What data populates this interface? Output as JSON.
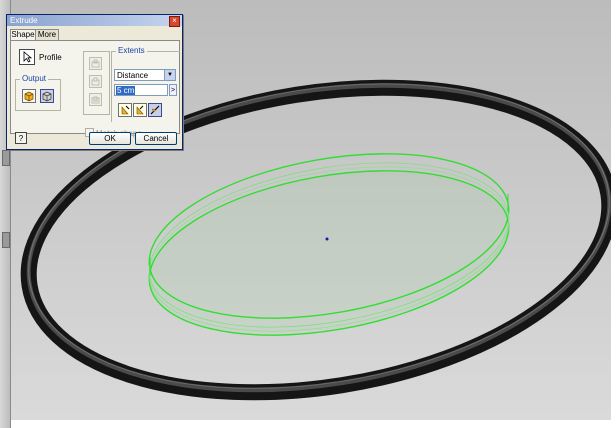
{
  "dialog": {
    "title": "Extrude",
    "close_glyph": "×",
    "tabs": [
      {
        "label": "Shape",
        "active": true
      },
      {
        "label": "More",
        "active": false
      }
    ],
    "profile_label": "Profile",
    "output_group_title": "Output",
    "extents_group_title": "Extents",
    "extents_type_value": "Distance",
    "distance_value": "5 cm",
    "distance_arrow": ">",
    "match_shape_label": "Match shape",
    "help_label": "?",
    "ok_label": "OK",
    "cancel_label": "Cancel"
  },
  "icons": {
    "profile": "select-arrow-icon",
    "output_solid": "solid-output-icon",
    "output_surface": "surface-output-icon",
    "direction_1": "direction-one-icon",
    "direction_2": "direction-two-icon",
    "direction_symmetric": "direction-symmetric-icon"
  },
  "colors": {
    "ring": "#1e1e1e",
    "preview": "#33dd33",
    "background_top": "#bdbdbd",
    "background_bottom": "#d9d9d9"
  }
}
